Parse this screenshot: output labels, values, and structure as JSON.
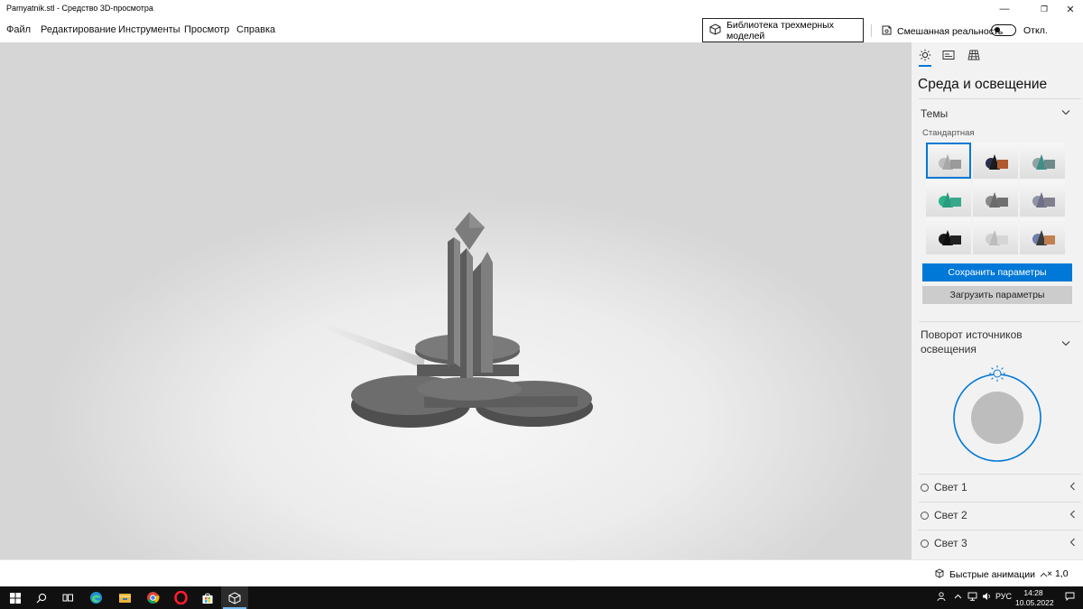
{
  "window": {
    "title": "Pamyatnik.stl - Средство 3D-просмотра",
    "minimize": "—",
    "restore": "❐",
    "close": "✕"
  },
  "menu": {
    "file": "Файл",
    "edit": "Редактирование",
    "tools": "Инструменты",
    "view": "Просмотр",
    "help": "Справка"
  },
  "toolbar": {
    "library_label": "Библиотека трехмерных моделей",
    "mixed_reality_label": "Смешанная реальность",
    "toggle_state": "Откл.",
    "toggle_on": false
  },
  "panel": {
    "tabs": [
      "sun-icon",
      "stats-icon",
      "grid-icon"
    ],
    "title": "Среда и освещение",
    "themes_header": "Темы",
    "standard_label": "Стандартная",
    "themes": [
      {
        "sphere": "#bdbdbd",
        "cone": "#a8a8a8",
        "cube": "#9a9a9a"
      },
      {
        "sphere": "#2a2f4a",
        "cone": "#1b1b1b",
        "cube": "#b0592e"
      },
      {
        "sphere": "#8fa3a3",
        "cone": "#3f8f86",
        "cube": "#6f8a88"
      },
      {
        "sphere": "#2fb089",
        "cone": "#2a9c7e",
        "cube": "#37a88c"
      },
      {
        "sphere": "#8a8a8a",
        "cone": "#6b6b6b",
        "cube": "#707070"
      },
      {
        "sphere": "#8f93a8",
        "cone": "#6f6f88",
        "cube": "#80808f"
      },
      {
        "sphere": "#1a1a1a",
        "cone": "#0f0f0f",
        "cube": "#222222"
      },
      {
        "sphere": "#cfcfcf",
        "cone": "#bdbdbd",
        "cube": "#d6d6d6"
      },
      {
        "sphere": "#6d7fa8",
        "cone": "#3b3b3b",
        "cube": "#c08050"
      }
    ],
    "save_label": "Сохранить параметры",
    "load_label": "Загрузить параметры",
    "rotation_header": "Поворот источников освещения",
    "lights": [
      "Свет 1",
      "Свет 2",
      "Свет 3"
    ],
    "accent": "#0078d7"
  },
  "status": {
    "animations_label": "Быстрые анимации",
    "speed": "× 1,0"
  },
  "taskbar": {
    "apps": [
      "windows-start-icon",
      "search-icon",
      "task-view-icon",
      "edge-icon",
      "file-explorer-icon",
      "chrome-icon",
      "opera-icon",
      "store-icon",
      "3d-viewer-icon"
    ],
    "lang": "РУС",
    "time": "14:28",
    "date": "10.05.2022"
  }
}
